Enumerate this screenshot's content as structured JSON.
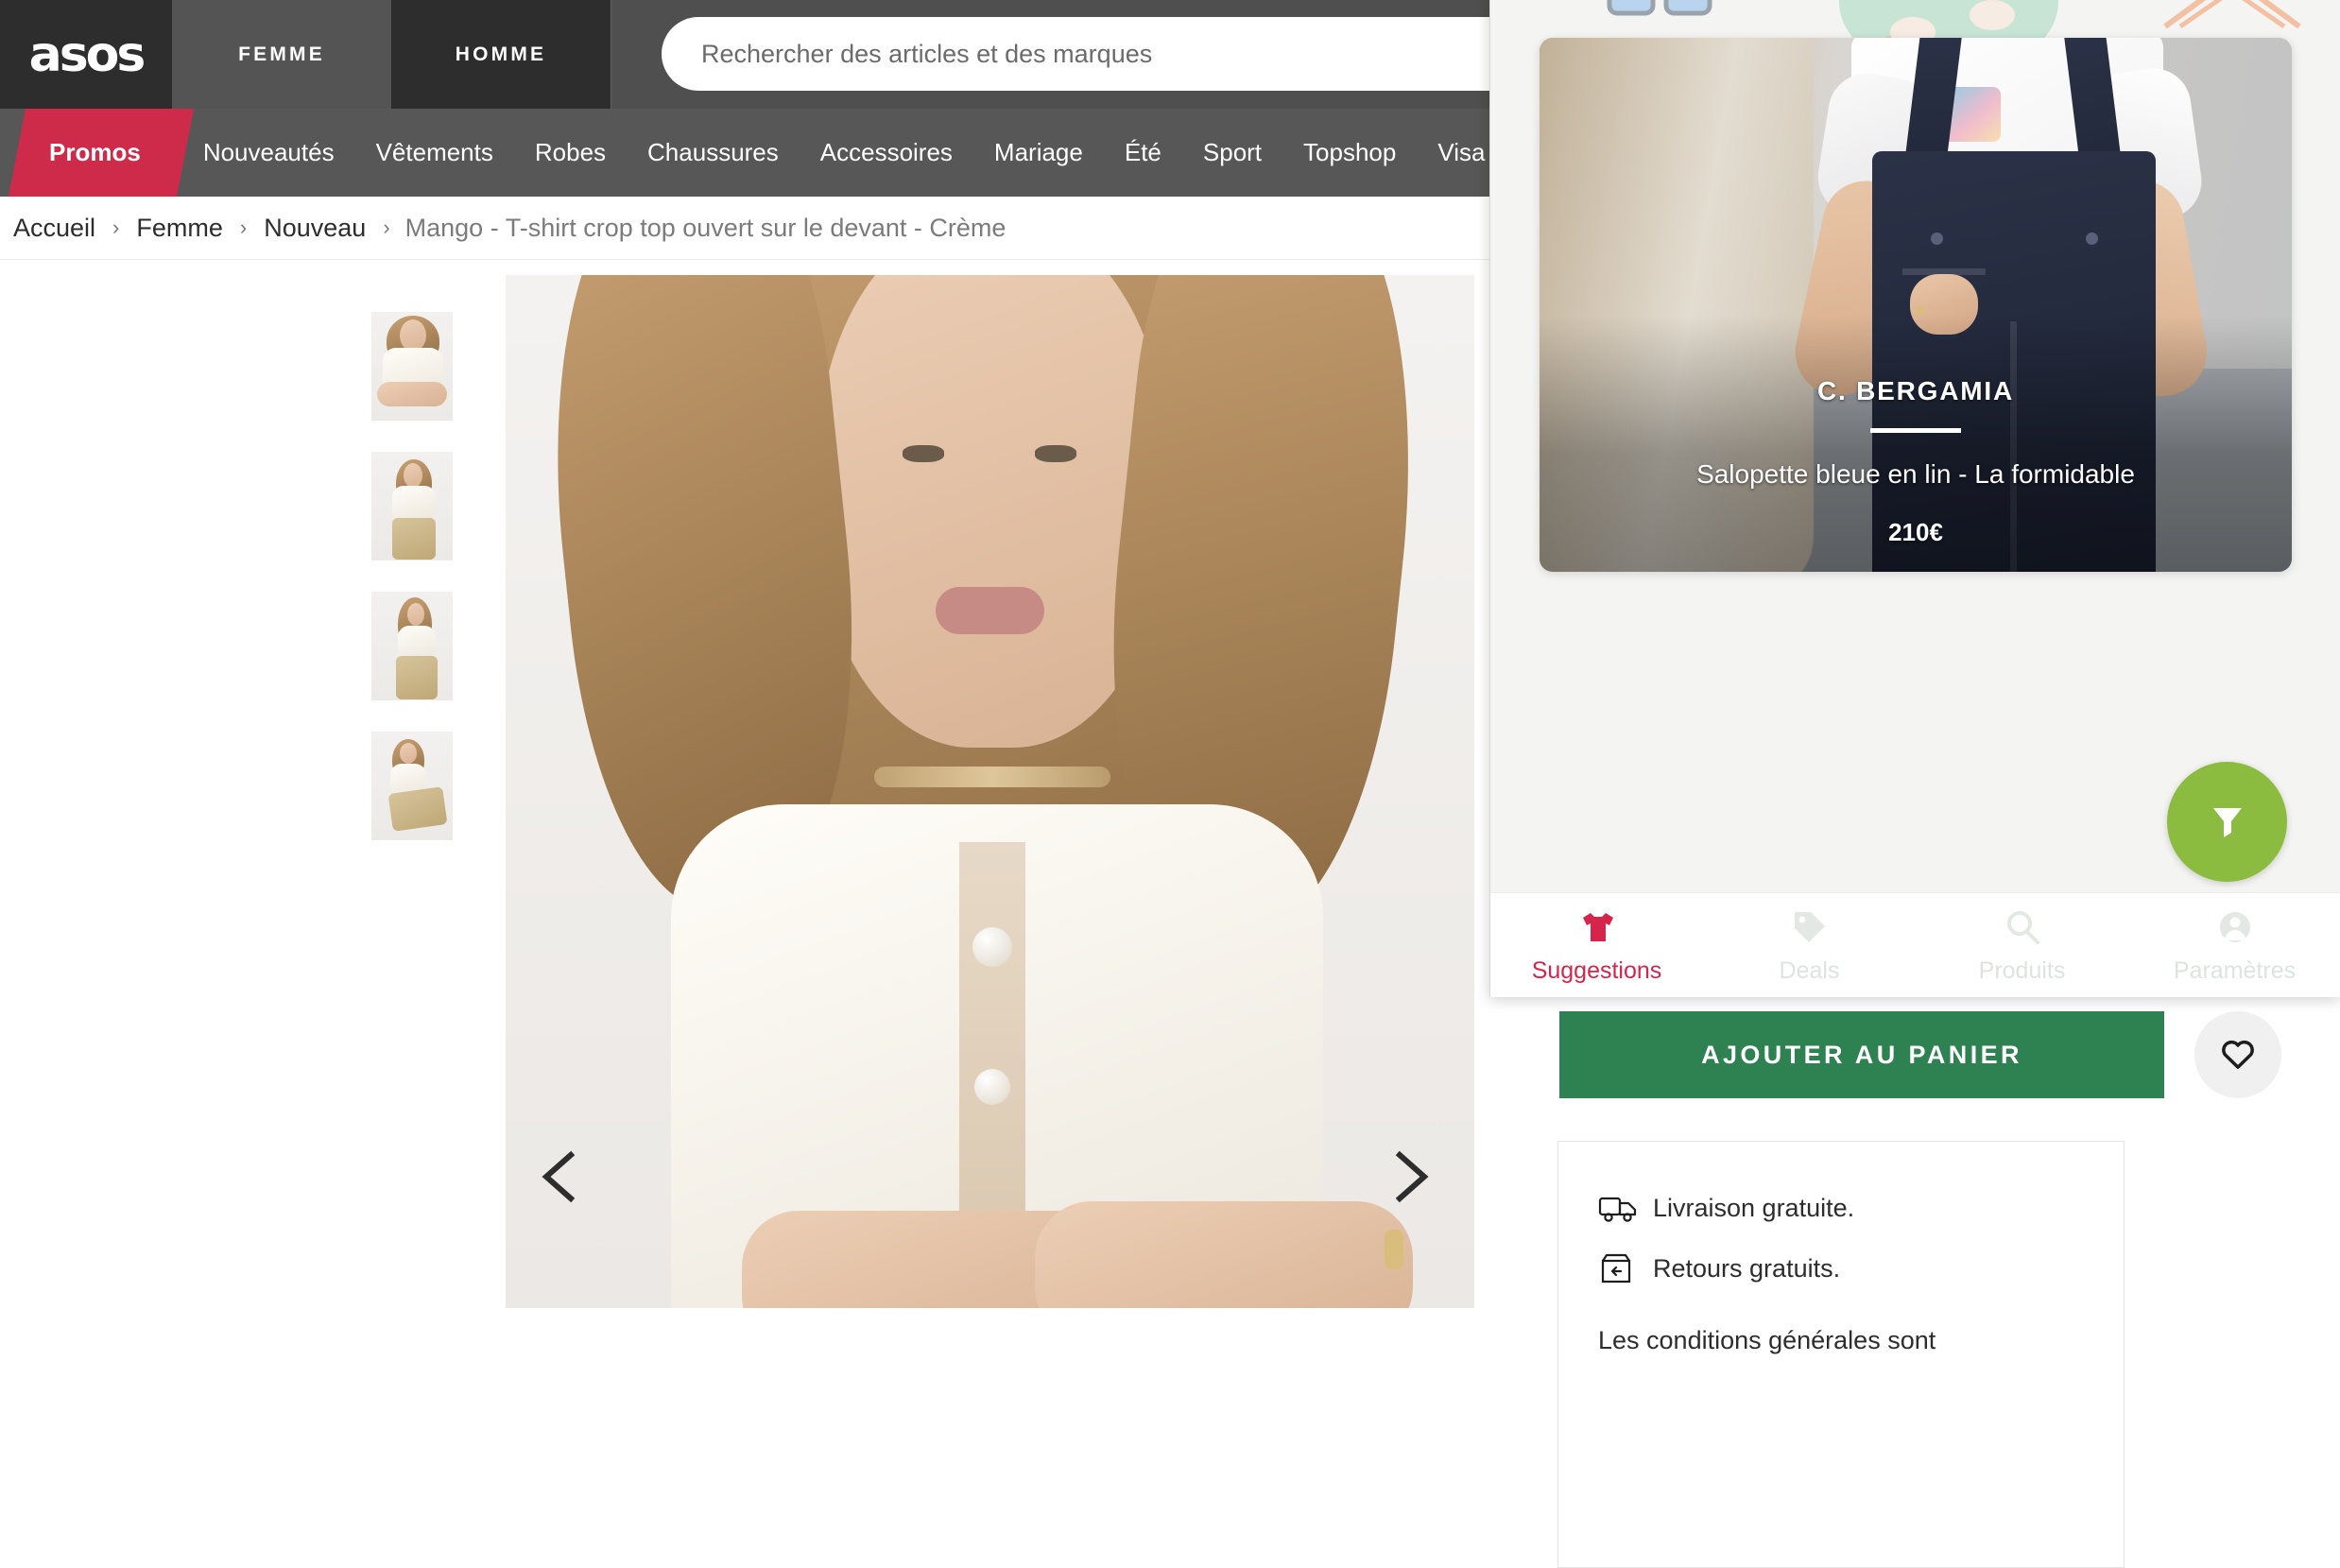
{
  "site": {
    "logo": "asos",
    "gender_tabs": [
      {
        "label": "FEMME",
        "active": true
      },
      {
        "label": "HOMME",
        "active": false
      }
    ],
    "search": {
      "placeholder": "Rechercher des articles et des marques",
      "value": ""
    },
    "categories": [
      {
        "label": "Promos",
        "highlight": true
      },
      {
        "label": "Nouveautés"
      },
      {
        "label": "Vêtements"
      },
      {
        "label": "Robes"
      },
      {
        "label": "Chaussures"
      },
      {
        "label": "Accessoires"
      },
      {
        "label": "Mariage"
      },
      {
        "label": "Été"
      },
      {
        "label": "Sport"
      },
      {
        "label": "Topshop"
      },
      {
        "label": "Visa"
      }
    ],
    "breadcrumb": {
      "items": [
        "Accueil",
        "Femme",
        "Nouveau"
      ],
      "separator": "›",
      "current": "Mango - T-shirt crop top ouvert sur le devant - Crème"
    },
    "gallery": {
      "prev_label": "‹",
      "next_label": "›",
      "thumbnail_count": 4
    },
    "product": {
      "add_to_cart_label": "AJOUTER AU PANIER",
      "favourite_icon": "heart-icon",
      "info": [
        {
          "icon": "delivery-truck-icon",
          "text": "Livraison gratuite."
        },
        {
          "icon": "return-box-icon",
          "text": "Retours gratuits."
        }
      ],
      "terms_note": "Les conditions générales sont"
    }
  },
  "overlay": {
    "decorations": [
      "glasses-illustration",
      "sweater-illustration",
      "hanger-illustration"
    ],
    "suggestion_card": {
      "brand": "C. BERGAMIA",
      "name": "Salopette bleue en lin - La formidable",
      "price": "210€"
    },
    "filter_button": {
      "icon": "filter-funnel-icon",
      "color": "#8cbc3f"
    },
    "tabs": [
      {
        "label": "Suggestions",
        "icon": "tshirt-icon",
        "active": true
      },
      {
        "label": "Deals",
        "icon": "tag-icon",
        "active": false
      },
      {
        "label": "Produits",
        "icon": "search-icon",
        "active": false
      },
      {
        "label": "Paramètres",
        "icon": "account-icon",
        "active": false
      }
    ],
    "accent_color": "#d7244a",
    "inactive_color": "#dfe3e0"
  }
}
